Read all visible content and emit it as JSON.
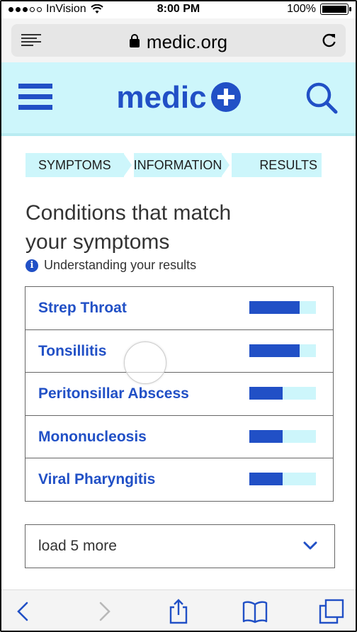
{
  "status_bar": {
    "carrier": "InVision",
    "time": "8:00 PM",
    "battery": "100%"
  },
  "browser": {
    "url": "medic.org"
  },
  "site": {
    "brand": "medic"
  },
  "steps": [
    "SYMPTOMS",
    "INFORMATION",
    "RESULTS"
  ],
  "page": {
    "title_line1": "Conditions that match",
    "title_line2": "your symptoms",
    "info_icon": "i",
    "understanding_link": "Understanding your results"
  },
  "results": [
    {
      "name": "Strep Throat",
      "match": 0.75
    },
    {
      "name": "Tonsillitis",
      "match": 0.75
    },
    {
      "name": "Peritonsillar Abscess",
      "match": 0.5
    },
    {
      "name": "Mononucleosis",
      "match": 0.5
    },
    {
      "name": "Viral Pharyngitis",
      "match": 0.5
    }
  ],
  "load_more": {
    "label": "load 5 more"
  },
  "colors": {
    "brand_blue": "#2150c6",
    "light_cyan": "#cdf6fb"
  }
}
